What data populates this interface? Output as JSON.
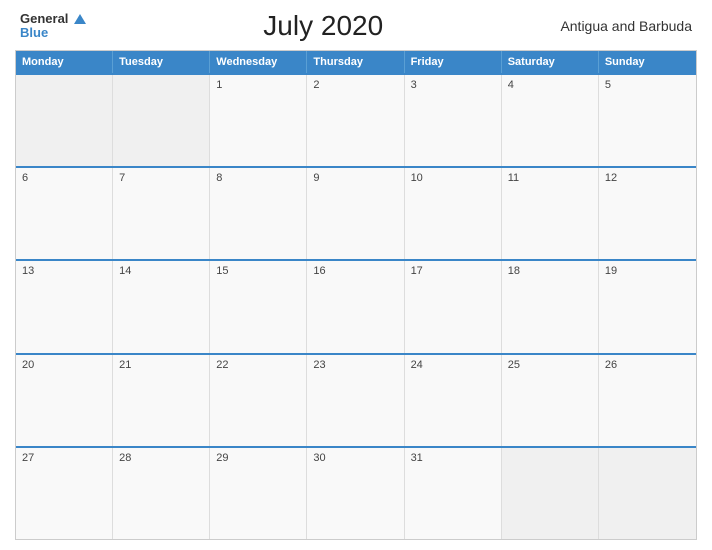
{
  "header": {
    "logo_general": "General",
    "logo_blue": "Blue",
    "title": "July 2020",
    "country": "Antigua and Barbuda"
  },
  "calendar": {
    "day_headers": [
      "Monday",
      "Tuesday",
      "Wednesday",
      "Thursday",
      "Friday",
      "Saturday",
      "Sunday"
    ],
    "weeks": [
      [
        {
          "num": "",
          "empty": true
        },
        {
          "num": "",
          "empty": true
        },
        {
          "num": "1",
          "empty": false
        },
        {
          "num": "2",
          "empty": false
        },
        {
          "num": "3",
          "empty": false
        },
        {
          "num": "4",
          "empty": false
        },
        {
          "num": "5",
          "empty": false
        }
      ],
      [
        {
          "num": "6",
          "empty": false
        },
        {
          "num": "7",
          "empty": false
        },
        {
          "num": "8",
          "empty": false
        },
        {
          "num": "9",
          "empty": false
        },
        {
          "num": "10",
          "empty": false
        },
        {
          "num": "11",
          "empty": false
        },
        {
          "num": "12",
          "empty": false
        }
      ],
      [
        {
          "num": "13",
          "empty": false
        },
        {
          "num": "14",
          "empty": false
        },
        {
          "num": "15",
          "empty": false
        },
        {
          "num": "16",
          "empty": false
        },
        {
          "num": "17",
          "empty": false
        },
        {
          "num": "18",
          "empty": false
        },
        {
          "num": "19",
          "empty": false
        }
      ],
      [
        {
          "num": "20",
          "empty": false
        },
        {
          "num": "21",
          "empty": false
        },
        {
          "num": "22",
          "empty": false
        },
        {
          "num": "23",
          "empty": false
        },
        {
          "num": "24",
          "empty": false
        },
        {
          "num": "25",
          "empty": false
        },
        {
          "num": "26",
          "empty": false
        }
      ],
      [
        {
          "num": "27",
          "empty": false
        },
        {
          "num": "28",
          "empty": false
        },
        {
          "num": "29",
          "empty": false
        },
        {
          "num": "30",
          "empty": false
        },
        {
          "num": "31",
          "empty": false
        },
        {
          "num": "",
          "empty": true
        },
        {
          "num": "",
          "empty": true
        }
      ]
    ]
  }
}
